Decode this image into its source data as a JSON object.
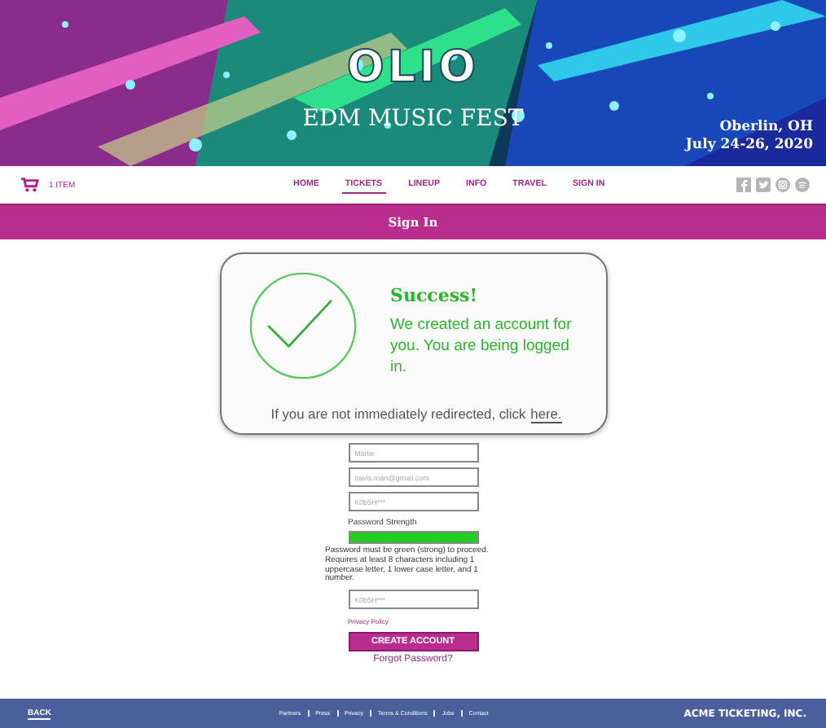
{
  "header": {
    "logo": "OLIO",
    "subtitle": "EDM MUSIC FEST",
    "location": "Oberlin, OH",
    "dates": "July 24-26, 2020"
  },
  "cart": {
    "label": "1 ITEM"
  },
  "nav": [
    {
      "label": "HOME",
      "selected": false
    },
    {
      "label": "TICKETS",
      "selected": true
    },
    {
      "label": "LINEUP",
      "selected": false
    },
    {
      "label": "INFO",
      "selected": false
    },
    {
      "label": "TRAVEL",
      "selected": false
    },
    {
      "label": "SIGN IN",
      "selected": false
    }
  ],
  "page_title": "Sign In",
  "dialog": {
    "title": "Success!",
    "message": "We created an account for you. You are being logged in.",
    "redirect_text": "If you are not immediately redirected, click",
    "link": "here."
  },
  "form": {
    "fields": [
      {
        "value": "Martie"
      },
      {
        "value": "travis.man@gmail.com"
      },
      {
        "value": "K0b5H***"
      }
    ],
    "strength_label": "Password Strength",
    "strength": {
      "level": 1.0
    },
    "hint": "Password must be green (strong) to proceed. Requires at least 8 characters including 1 uppercase letter, 1 lower case letter, and 1 number.",
    "confirm": {
      "value": "K0b5H***"
    },
    "privacy": "Privacy Policy",
    "submit": "CREATE ACCOUNT",
    "forgot": "Forgot Password?"
  },
  "footer": {
    "back": "BACK",
    "links": [
      "Partners",
      "Press",
      "Privacy",
      "Terms & Conditions",
      "Jobs",
      "Contact"
    ],
    "company": "ACME TICKETING, INC."
  }
}
